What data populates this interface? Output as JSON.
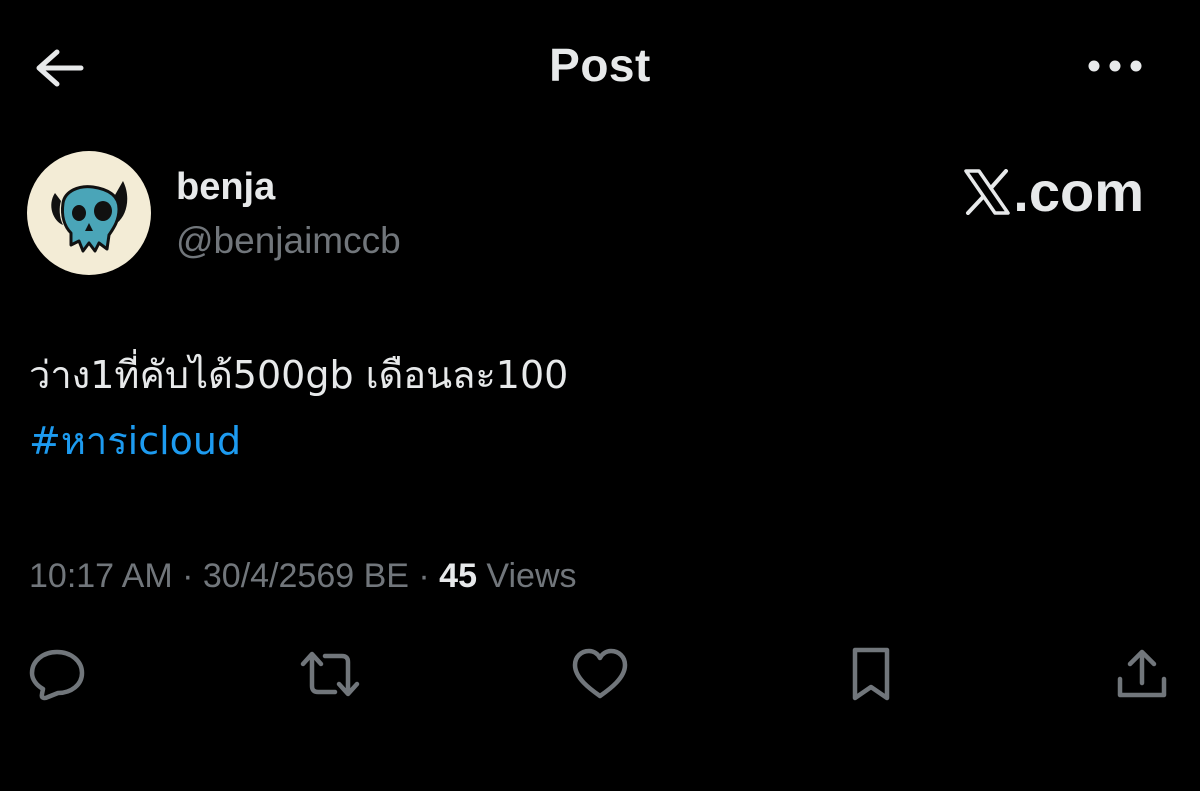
{
  "header": {
    "title": "Post",
    "back_icon": "arrow-left-icon",
    "more_icon": "more-horizontal-icon"
  },
  "author": {
    "display_name": "benja",
    "handle": "@benjaimccb",
    "avatar_icon": "skull-horns-avatar"
  },
  "brand": {
    "text": ".com",
    "logo_icon": "x-logo-icon"
  },
  "post": {
    "text": "ว่าง1ที่คับได้500gb เดือนละ100",
    "hashtag": "#หารicloud"
  },
  "meta": {
    "time": "10:17 AM",
    "separator": " · ",
    "date": "30/4/2569 BE",
    "views_count": "45",
    "views_label": " Views"
  },
  "actions": [
    {
      "name": "reply",
      "icon": "reply-icon"
    },
    {
      "name": "repost",
      "icon": "repost-icon"
    },
    {
      "name": "like",
      "icon": "heart-icon"
    },
    {
      "name": "bookmark",
      "icon": "bookmark-icon"
    },
    {
      "name": "share",
      "icon": "share-icon"
    }
  ],
  "colors": {
    "background": "#000000",
    "text_primary": "#e7e9ea",
    "text_secondary": "#71767b",
    "link": "#1d9bf0",
    "avatar_bg": "#f3ecd6",
    "skull": "#4aa5b8"
  }
}
